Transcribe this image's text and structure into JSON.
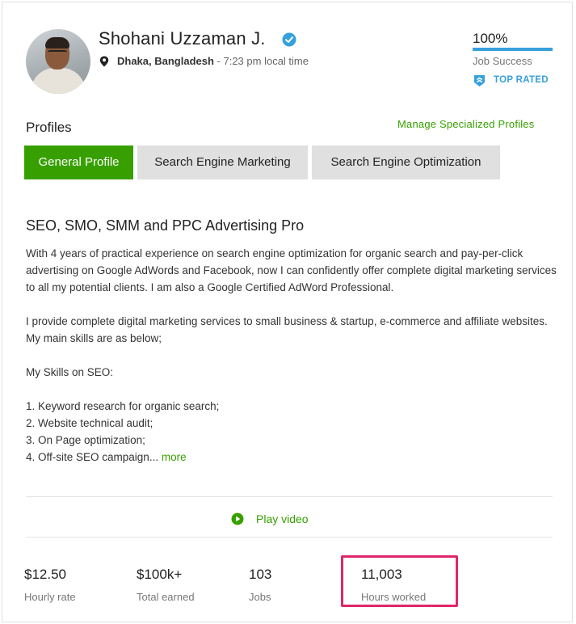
{
  "header": {
    "name": "Shohani Uzzaman J.",
    "location_city": "Dhaka, Bangladesh",
    "local_time": " - 7:23 pm local time",
    "job_success": {
      "value": "100%",
      "label": "Job Success",
      "progress": 1.0
    },
    "badge": "TOP RATED",
    "icons": [
      "avatar",
      "verified-check-icon",
      "location-pin-icon",
      "top-rated-shield-icon"
    ]
  },
  "profiles": {
    "heading": "Profiles",
    "manage_link": "Manage Specialized Profiles",
    "tabs": [
      {
        "label": "General Profile",
        "active": true
      },
      {
        "label": "Search Engine Marketing",
        "active": false
      },
      {
        "label": "Search Engine Optimization",
        "active": false
      }
    ]
  },
  "overview": {
    "title": "SEO, SMO, SMM and PPC Advertising Pro",
    "paragraph1": "With 4 years of practical experience on search engine optimization for organic search and pay-per-click advertising on Google AdWords and Facebook, now I can confidently offer complete digital marketing services to all my potential clients. I am also a Google Certified AdWord Professional.",
    "paragraph2": "I provide complete digital marketing services to small business & startup, e-commerce and affiliate websites. My main skills are as below;",
    "skills_heading": "My Skills on SEO:",
    "skills": [
      "1. Keyword research for organic search;",
      "2. Website technical audit;",
      "3. On Page optimization;",
      "4. Off-site SEO campaign..."
    ],
    "more_link": "more"
  },
  "video": {
    "label": "Play video"
  },
  "stats": [
    {
      "value": "$12.50",
      "label": "Hourly rate"
    },
    {
      "value": "$100k+",
      "label": "Total earned"
    },
    {
      "value": "103",
      "label": "Jobs"
    },
    {
      "value": "11,003",
      "label": "Hours worked"
    }
  ],
  "colors": {
    "accent_green": "#37a000",
    "brand_blue": "#37a0dc",
    "highlight_pink": "#e0266a",
    "tab_inactive": "#e0e0e0"
  }
}
